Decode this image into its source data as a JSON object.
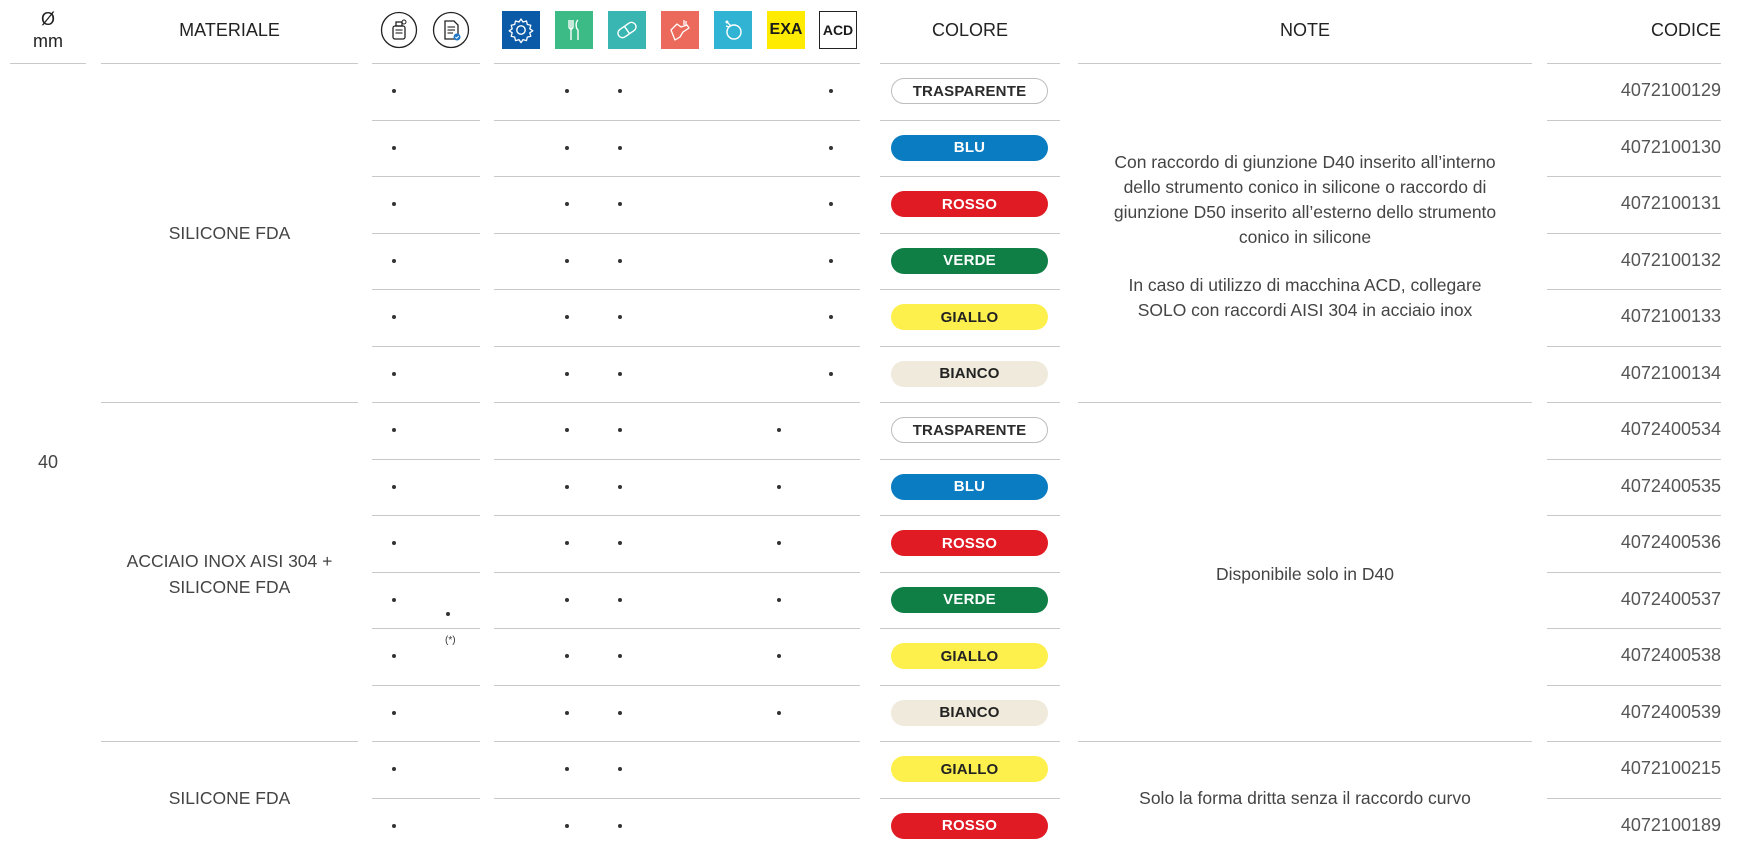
{
  "header": {
    "diameter": "Ø",
    "diameter_unit": "mm",
    "material": "MATERIALE",
    "color": "COLORE",
    "notes": "NOTE",
    "code": "CODICE",
    "icons": [
      "bottle-icon",
      "certificate-icon",
      "gear-icon",
      "cutlery-icon",
      "pill-icon",
      "hand-pour-icon",
      "cosmetics-icon"
    ],
    "badge_exa": "EXA",
    "badge_acd": "ACD",
    "icon_colors": {
      "gear": "#0a5aa8",
      "cutlery": "#3dbb86",
      "pill": "#39b6b1",
      "hand": "#ec6a5c",
      "cosmetics": "#31b4d3",
      "exa": "#ffeb00"
    }
  },
  "diameter_value": "40",
  "groups": [
    {
      "material": "SILICONE FDA",
      "note_lines": [
        "Con raccordo di giunzione D40 inserito all’interno",
        "dello strumento conico in silicone o raccordo di",
        "giunzione D50 inserito all’esterno dello strumento",
        "conico in silicone"
      ],
      "note_lines_2": [
        "In caso di utilizzo di macchina ACD, collegare",
        "SOLO con raccordi AISI 304 in acciaio inox"
      ]
    },
    {
      "material_lines": [
        "ACCIAIO INOX AISI 304 +",
        "SILICONE FDA"
      ],
      "note": "Disponibile solo in D40",
      "cert_note": "(*)"
    },
    {
      "material": "SILICONE FDA",
      "note": "Solo la forma dritta senza il raccordo curvo"
    }
  ],
  "colors": {
    "trasparente": "#ffffff",
    "blu": "#0a7cc2",
    "rosso": "#e01b24",
    "verde": "#0f7f46",
    "giallo": "#fdf04c",
    "bianco": "#efeadb"
  },
  "rows": [
    {
      "colore": "TRASPARENTE",
      "codice": "4072100129"
    },
    {
      "colore": "BLU",
      "codice": "4072100130"
    },
    {
      "colore": "ROSSO",
      "codice": "4072100131"
    },
    {
      "colore": "VERDE",
      "codice": "4072100132"
    },
    {
      "colore": "GIALLO",
      "codice": "4072100133"
    },
    {
      "colore": "BIANCO",
      "codice": "4072100134"
    },
    {
      "colore": "TRASPARENTE",
      "codice": "4072400534"
    },
    {
      "colore": "BLU",
      "codice": "4072400535"
    },
    {
      "colore": "ROSSO",
      "codice": "4072400536"
    },
    {
      "colore": "VERDE",
      "codice": "4072400537"
    },
    {
      "colore": "GIALLO",
      "codice": "4072400538"
    },
    {
      "colore": "BIANCO",
      "codice": "4072400539"
    },
    {
      "colore": "GIALLO",
      "codice": "4072100215"
    },
    {
      "colore": "ROSSO",
      "codice": "4072100189"
    }
  ]
}
